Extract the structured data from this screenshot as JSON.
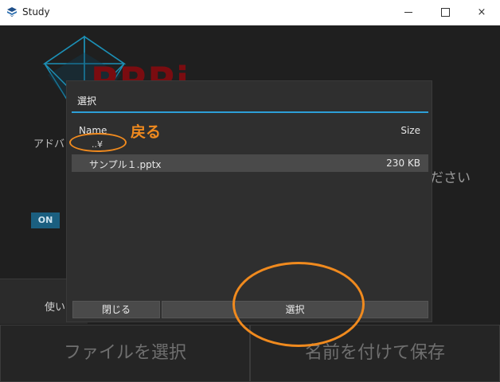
{
  "window": {
    "title": "Study",
    "icon": "app-logo-icon",
    "controls": {
      "minimize": "minimize-icon",
      "maximize": "maximize-icon",
      "close": "×"
    }
  },
  "background": {
    "logo_text": "PPPi",
    "advanced_label": "アドバ",
    "please_label": "ださい",
    "toggle_label": "ON",
    "use_label": "使い",
    "file_select_button": "ファイルを選択",
    "save_as_button": "名前を付けて保存"
  },
  "dialog": {
    "title": "選択",
    "columns": {
      "name": "Name",
      "size": "Size"
    },
    "parent_dir": "..¥",
    "files": [
      {
        "name": "サンプル１.pptx",
        "size": "230 KB"
      }
    ],
    "close_button": "閉じる",
    "select_button": "選択"
  },
  "annotations": {
    "back_label": "戻る",
    "color": "#f08a1e"
  },
  "colors": {
    "accent": "#2d9fd8",
    "logo_red": "#7a0c10",
    "toggle_blue": "#1b5f80"
  }
}
